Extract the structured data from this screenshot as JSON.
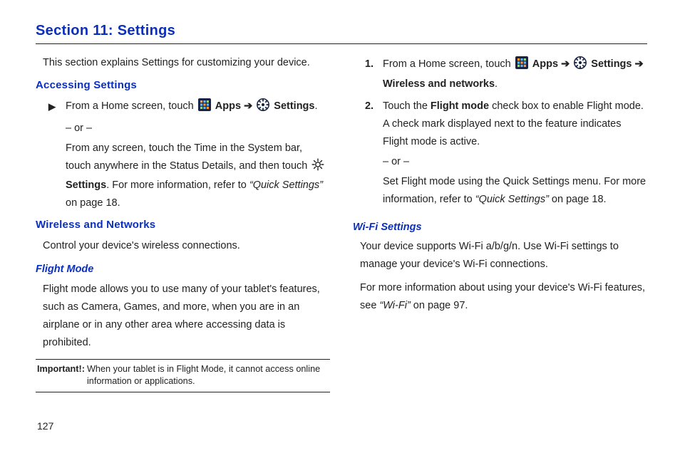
{
  "section_title": "Section 11: Settings",
  "page_number": "127",
  "icons": {
    "apps": "apps-icon",
    "settings": "settings-icon",
    "settings_light": "settings-light-icon"
  },
  "left": {
    "intro": "This section explains Settings for customizing your device.",
    "h2_1": "Accessing Settings",
    "step1_a": "From a Home screen, touch ",
    "apps_label": "Apps",
    "arrow": " ➔ ",
    "settings_label": "Settings",
    "period": ".",
    "or": "– or –",
    "alt1": "From any screen, touch the Time in the System bar, touch anywhere in the Status Details, and then touch ",
    "alt2_settings": "Settings",
    "alt3": ". For more information, refer to ",
    "alt4_ref": "“Quick Settings”",
    "alt5": " on page 18.",
    "h2_2": "Wireless and Networks",
    "wn_para": "Control your device's wireless connections.",
    "h3_1": "Flight Mode",
    "fm_para": "Flight mode allows you to use many of your tablet's features, such as Camera, Games, and more, when you are in an airplane or in any other area where accessing data is prohibited.",
    "important_label": "Important!:",
    "important_text": "When your tablet is in Flight Mode, it cannot access online information or applications."
  },
  "right": {
    "n1": "1.",
    "n2": "2.",
    "r1_a": "From a Home screen, touch ",
    "apps_label": "Apps",
    "arrow": " ➔ ",
    "settings_label": "Settings",
    "r1_b": "Wireless and networks",
    "period": ".",
    "r2_a": "Touch the ",
    "r2_b": "Flight mode",
    "r2_c": " check box to enable Flight mode. A check mark displayed next to the feature indicates Flight mode is active.",
    "or": "– or –",
    "r2_d": "Set Flight mode using the Quick Settings menu. For more information, refer to ",
    "r2_ref": "“Quick Settings”",
    "r2_e": " on page 18.",
    "h3": "Wi-Fi Settings",
    "wifi_p1": "Your device supports Wi-Fi a/b/g/n. Use Wi-Fi settings to manage your device's Wi-Fi connections.",
    "wifi_p2a": "For more information about using your device's Wi-Fi features, see ",
    "wifi_ref": "“Wi-Fi”",
    "wifi_p2b": " on page 97."
  }
}
